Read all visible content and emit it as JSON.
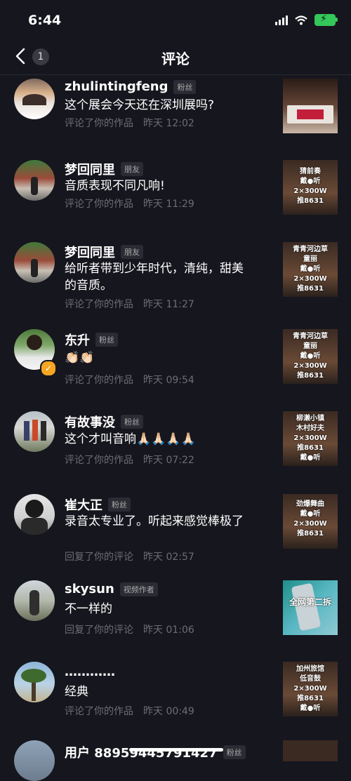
{
  "status": {
    "time": "6:44"
  },
  "nav": {
    "title": "评论",
    "badge": "1"
  },
  "items": [
    {
      "name": "zhulintingfeng",
      "tag": "粉丝",
      "comment": "这个展会今天还在深圳展吗?",
      "action": "评论了你的作品",
      "time": "昨天 12:02",
      "thumb_text": ""
    },
    {
      "name": "梦回同里",
      "tag": "朋友",
      "comment": "音质表现不同凡响!",
      "action": "评论了你的作品",
      "time": "昨天 11:29",
      "thumb_text": "猜前奏\n戴●听\n2×300W\n推8631"
    },
    {
      "name": "梦回同里",
      "tag": "朋友",
      "comment": "给听者带到少年时代，清纯，甜美的音质。",
      "action": "评论了你的作品",
      "time": "昨天 11:27",
      "thumb_text": "青青河边草\n童丽\n戴●听\n2×300W\n推8631"
    },
    {
      "name": "东升",
      "tag": "粉丝",
      "comment": "👏🏻👏🏻",
      "action": "评论了你的作品",
      "time": "昨天 09:54",
      "thumb_text": "青青河边草\n童丽\n戴●听\n2×300W\n推8631"
    },
    {
      "name": "有故事没",
      "tag": "粉丝",
      "comment": "这个才叫音响🙏🏻🙏🏻🙏🏻🙏🏻",
      "action": "评论了你的作品",
      "time": "昨天 07:22",
      "thumb_text": "柳濑小镇\n木村好夫\n2×300W\n推8631\n戴●听"
    },
    {
      "name": "崔大正",
      "tag": "粉丝",
      "comment": "录音太专业了。听起来感觉棒极了",
      "action": "回复了你的评论",
      "time": "昨天 02:57",
      "thumb_text": "劲爆舞曲\n戴●听\n2×300W\n推8631"
    },
    {
      "name": "skysun",
      "tag": "视频作者",
      "comment": "不一样的",
      "action": "回复了你的评论",
      "time": "昨天 01:06",
      "thumb_text": "全网第二拆"
    },
    {
      "name": "…………",
      "tag": "",
      "comment": "经典",
      "action": "评论了你的作品",
      "time": "昨天 00:49",
      "thumb_text": "加州旅馆\n低音鼓\n2×300W\n推8631\n戴●听"
    },
    {
      "name": "用户 88959445791427",
      "tag": "粉丝",
      "comment": "",
      "action": "",
      "time": "",
      "thumb_text": ""
    }
  ]
}
